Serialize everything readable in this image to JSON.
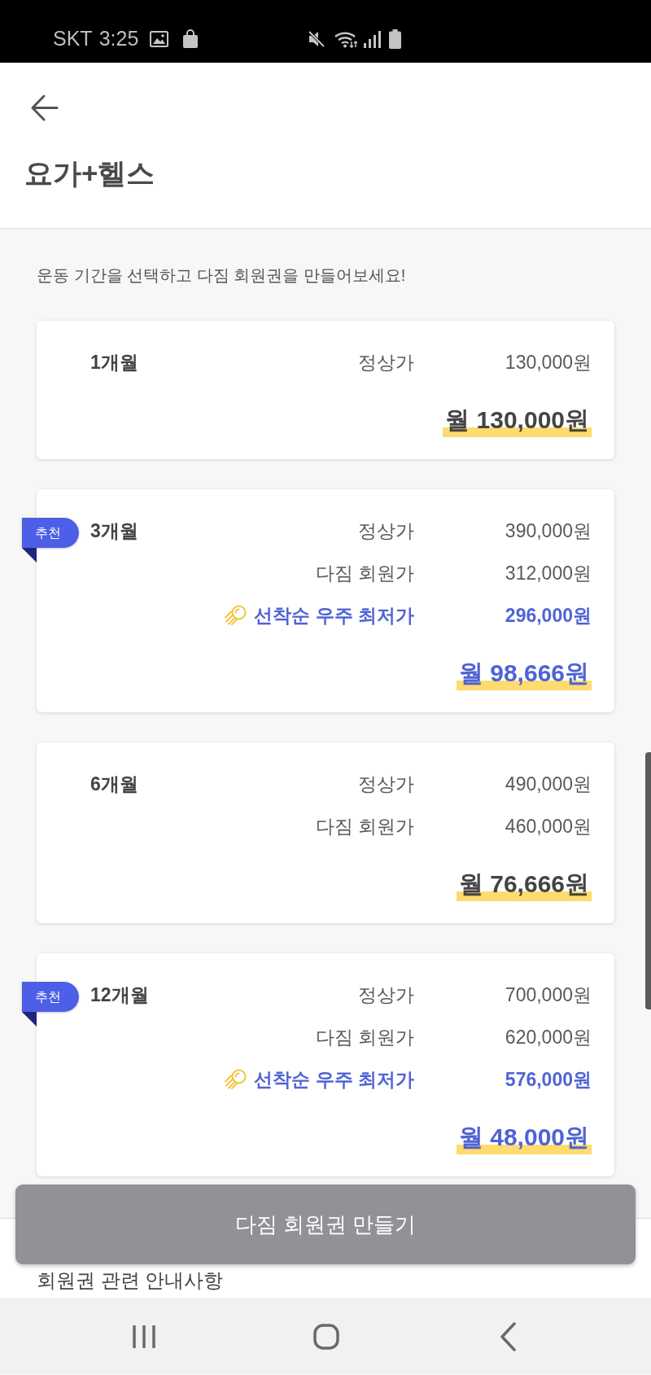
{
  "status_bar": {
    "carrier": "SKT",
    "time": "3:25"
  },
  "header": {
    "title": "요가+헬스"
  },
  "intro": "운동 기간을 선택하고 다짐 회원권을 만들어보세요!",
  "plans": [
    {
      "kind": "standard",
      "period": "1개월",
      "rows": [
        {
          "kind": "price",
          "label": "정상가",
          "price": "130,000원"
        }
      ],
      "monthly": "월 130,000원"
    },
    {
      "kind": "recommended",
      "badge": "추천",
      "period": "3개월",
      "rows": [
        {
          "kind": "price",
          "label": "정상가",
          "price": "390,000원"
        },
        {
          "kind": "price",
          "label": "다짐 회원가",
          "price": "312,000원"
        },
        {
          "kind": "promo",
          "label": "선착순 우주 최저가",
          "price": "296,000원"
        }
      ],
      "monthly": "월 98,666원"
    },
    {
      "kind": "standard",
      "period": "6개월",
      "rows": [
        {
          "kind": "price",
          "label": "정상가",
          "price": "490,000원"
        },
        {
          "kind": "price",
          "label": "다짐 회원가",
          "price": "460,000원"
        }
      ],
      "monthly": "월 76,666원"
    },
    {
      "kind": "recommended",
      "badge": "추천",
      "period": "12개월",
      "rows": [
        {
          "kind": "price",
          "label": "정상가",
          "price": "700,000원"
        },
        {
          "kind": "price",
          "label": "다짐 회원가",
          "price": "620,000원"
        },
        {
          "kind": "promo",
          "label": "선착순 우주 최저가",
          "price": "576,000원"
        }
      ],
      "monthly": "월 48,000원"
    }
  ],
  "create_button": {
    "label": "다짐 회원권 만들기",
    "disabled": true
  },
  "notice": {
    "title": "회원권 관련 안내사항"
  }
}
